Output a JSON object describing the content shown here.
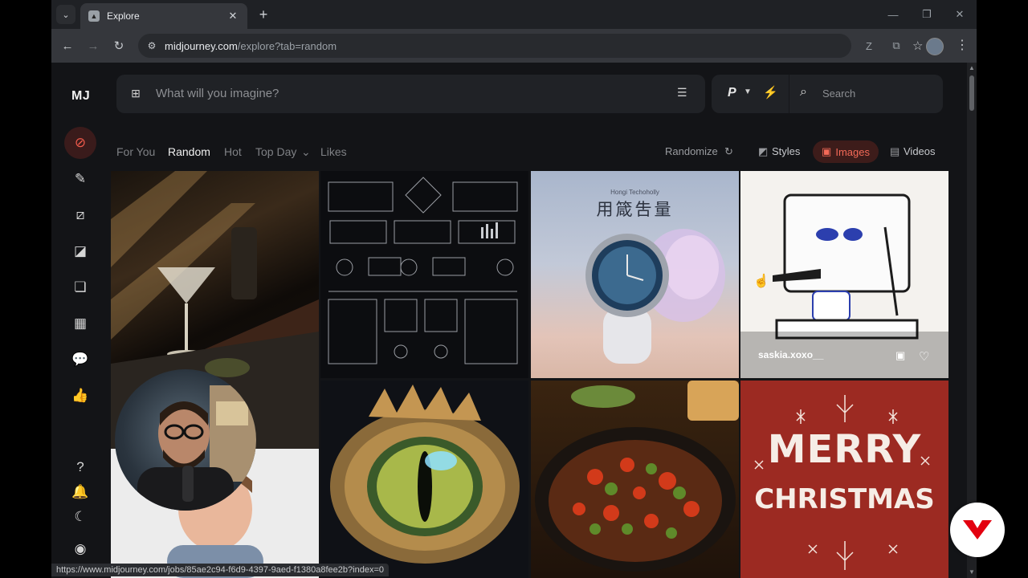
{
  "browser": {
    "tab_title": "Explore",
    "url_host": "midjourney.com",
    "url_path": "/explore?tab=random",
    "status_link": "https://www.midjourney.com/jobs/85ae2c94-f6d9-4397-9aed-f1380a8fee2b?index=0"
  },
  "sidebar": {
    "logo": "MJ"
  },
  "prompt": {
    "placeholder": "What will you imagine?"
  },
  "controls": {
    "p_label": "P",
    "search_placeholder": "Search"
  },
  "filters": {
    "for_you": "For You",
    "random": "Random",
    "hot": "Hot",
    "top_day": "Top Day",
    "likes": "Likes"
  },
  "right_controls": {
    "randomize": "Randomize",
    "styles": "Styles",
    "images": "Images",
    "videos": "Videos"
  },
  "tiles": {
    "watch_brand": "Hongi Techoholly",
    "watch_title": "用箴吿量",
    "espresso_user": "saskia.xoxo__",
    "christmas_line1": "MERRY",
    "christmas_line2": "CHRISTMAS"
  },
  "colors": {
    "accent": "#f05a4b",
    "page_bg": "#131417",
    "panel_bg": "#202226"
  }
}
